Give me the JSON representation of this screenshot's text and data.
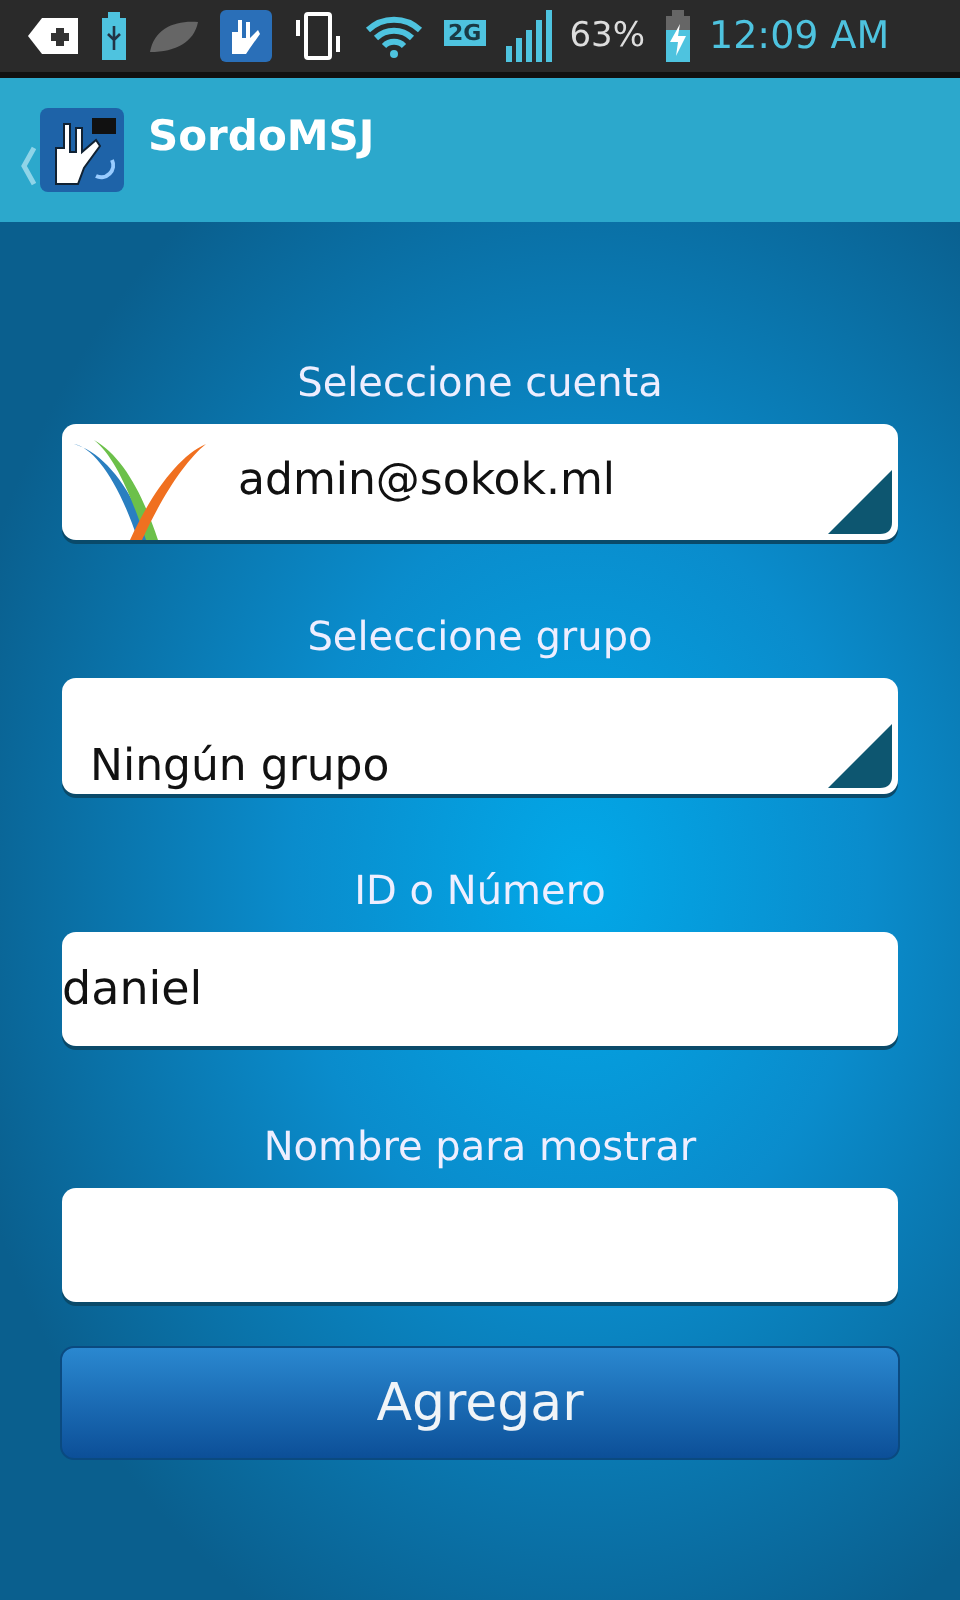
{
  "status_bar": {
    "network": "2G",
    "battery": "63%",
    "time": "12:09 AM"
  },
  "action_bar": {
    "title": "SordoMSJ"
  },
  "form": [
    {
      "kind": "spinner",
      "label": "Seleccione cuenta",
      "value": "admin@sokok.ml",
      "has_logo": true
    },
    {
      "kind": "spinner",
      "label": "Seleccione grupo",
      "value": "Ningún grupo",
      "has_logo": false
    },
    {
      "kind": "input",
      "label": "ID o Número",
      "value": "daniel"
    },
    {
      "kind": "input",
      "label": "Nombre para mostrar"
    }
  ],
  "button": {
    "label": "Agregar"
  }
}
